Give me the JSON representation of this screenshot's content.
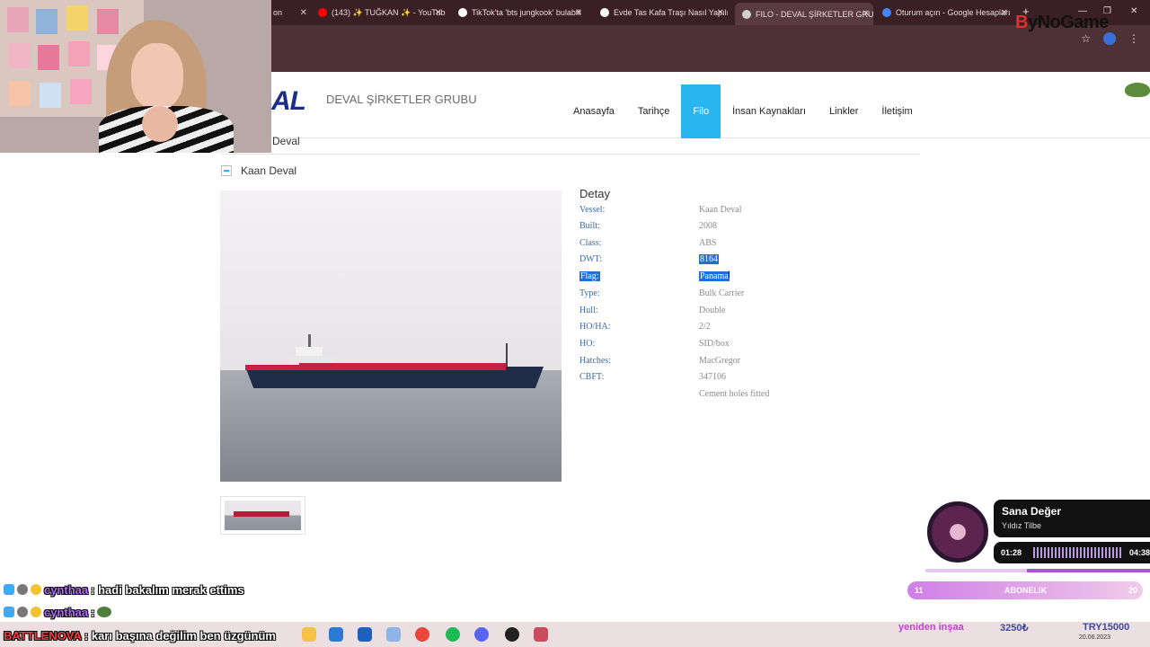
{
  "browser": {
    "tabs": [
      {
        "label": "on",
        "favicon_color": "#cfcfcf"
      },
      {
        "label": "(143) ✨ TUĞKAN ✨ - YouTube",
        "favicon_color": "#ff0000"
      },
      {
        "label": "TikTok'ta 'bts jungkook' bulabili",
        "favicon_color": "#ffffff"
      },
      {
        "label": "Evde Tas Kafa Traşı Nasıl Yapılır",
        "favicon_color": "#ffffff"
      },
      {
        "label": "FILO - DEVAL ŞİRKETLER GRUBU",
        "favicon_color": "#cfcfcf"
      },
      {
        "label": "Oturum açın - Google Hesapları",
        "favicon_color": "#4285f4"
      }
    ],
    "new_tab": "+",
    "star": "☆",
    "menu": "⋮"
  },
  "overlay_brand": {
    "b": "B",
    "rest": "yNoGame"
  },
  "site": {
    "logo_text": "AL",
    "brand": "DEVAL ŞİRKETLER GRUBU",
    "nav": [
      {
        "label": "Anasayfa",
        "active": false
      },
      {
        "label": "Tarihçe",
        "active": false
      },
      {
        "label": "Filo",
        "active": true
      },
      {
        "label": "İnsan Kaynakları",
        "active": false
      },
      {
        "label": "Linkler",
        "active": false
      },
      {
        "label": "İletişim",
        "active": false
      }
    ],
    "accent": "#29b6f0"
  },
  "content": {
    "prev_item": "Deval",
    "vessel_title": "Kaan Deval",
    "detail_title": "Detay",
    "details": [
      {
        "key": "Vessel:",
        "value": "Kaan Deval"
      },
      {
        "key": "Built:",
        "value": "2008"
      },
      {
        "key": "Class:",
        "value": "ABS"
      },
      {
        "key": "DWT:",
        "value": "8164"
      },
      {
        "key": "Flag:",
        "value": "Panama"
      },
      {
        "key": "Type:",
        "value": "Bulk Carrier"
      },
      {
        "key": "Hull:",
        "value": "Double"
      },
      {
        "key": "HO/HA:",
        "value": "2/2"
      },
      {
        "key": "HO:",
        "value": "SID/box"
      },
      {
        "key": "Hatches:",
        "value": "MacGregor"
      },
      {
        "key": "CBFT:",
        "value": "347106"
      },
      {
        "key": "",
        "value": "Cement holes fitted"
      }
    ]
  },
  "chat": [
    {
      "user": "cynthaa",
      "message": ": hadi bakalım merak ettims"
    },
    {
      "user": "cynthaa",
      "message": ":"
    },
    {
      "user": "BATTLENOVA",
      "message": ": karı başına değilim ben üzgünüm"
    }
  ],
  "music": {
    "title": "Sana Değer",
    "artist": "Yıldız Tilbe",
    "elapsed": "01:28",
    "duration": "04:38",
    "progress": 0.45
  },
  "subscription": {
    "left": "11",
    "label": "ABONELIK",
    "right": "20"
  },
  "goals": [
    {
      "label": "yeniden inşaa"
    },
    {
      "label": "3250₺"
    },
    {
      "label": "TRY15000"
    }
  ],
  "taskbar": {
    "date": "20.06.2023"
  }
}
